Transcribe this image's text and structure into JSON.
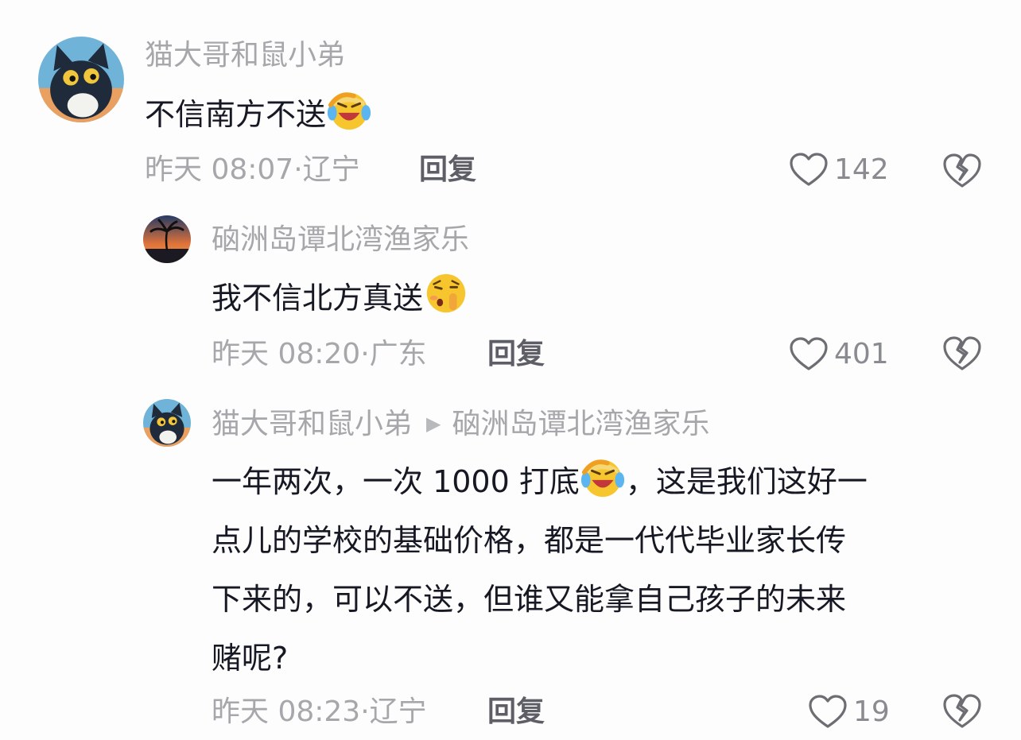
{
  "comments": [
    {
      "username": "猫大哥和鼠小弟",
      "text": "不信南方不送",
      "emoji": "laughing-crying-emoji",
      "time": "昨天 08:07",
      "location": "辽宁",
      "reply_label": "回复",
      "likes": "142"
    },
    {
      "username": "硇洲岛谭北湾渔家乐",
      "text": "我不信北方真送",
      "emoji": "shushing-emoji",
      "time": "昨天 08:20",
      "location": "广东",
      "reply_label": "回复",
      "likes": "401"
    },
    {
      "username": "猫大哥和鼠小弟",
      "reply_to": "硇洲岛谭北湾渔家乐",
      "text_lines": [
        "一年两次，一次 1000 打底",
        "，这是我们这好一",
        "点儿的学校的基础价格，都是一代代毕业家长传",
        "下来的，可以不送，但谁又能拿自己孩子的未来",
        "赌呢?"
      ],
      "emoji": "laughing-crying-emoji",
      "time": "昨天 08:23",
      "location": "辽宁",
      "reply_label": "回复",
      "likes": "19"
    }
  ],
  "separator": "·"
}
